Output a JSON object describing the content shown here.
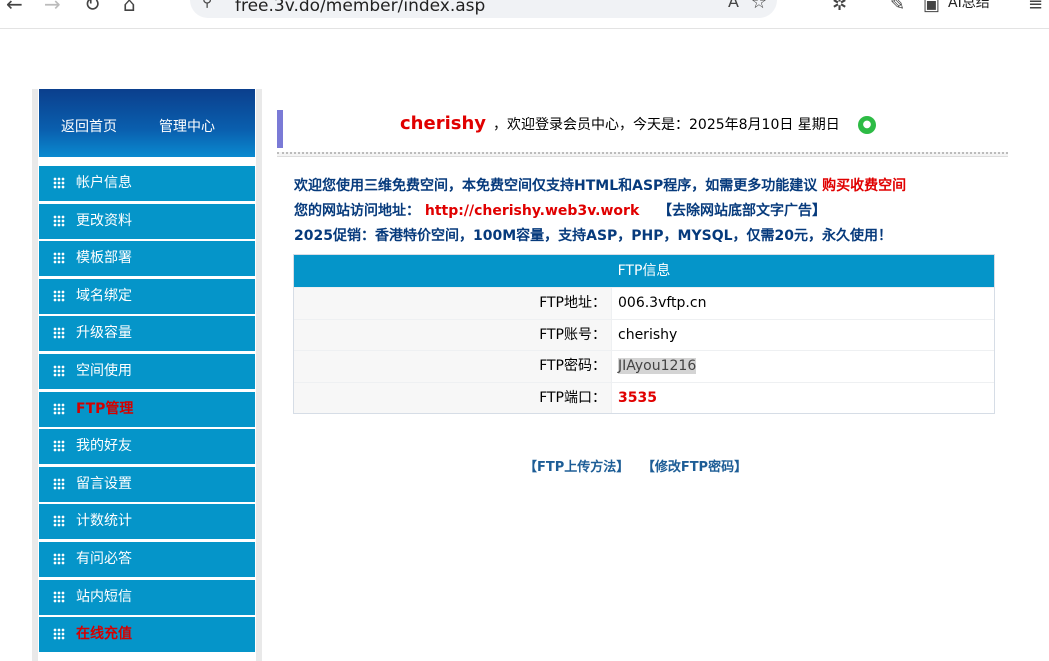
{
  "browser": {
    "url": "free.3v.do/member/index.asp",
    "ai_label": "AI总结"
  },
  "sidebar": {
    "header": [
      "返回首页",
      "管理中心"
    ],
    "items": [
      {
        "label": "帐户信息",
        "active": false
      },
      {
        "label": "更改资料",
        "active": false
      },
      {
        "label": "模板部署",
        "active": false
      },
      {
        "label": "域名绑定",
        "active": false
      },
      {
        "label": "升级容量",
        "active": false
      },
      {
        "label": "空间使用",
        "active": false
      },
      {
        "label": "FTP管理",
        "active": true
      },
      {
        "label": "我的好友",
        "active": false
      },
      {
        "label": "留言设置",
        "active": false
      },
      {
        "label": "计数统计",
        "active": false
      },
      {
        "label": "有问必答",
        "active": false
      },
      {
        "label": "站内短信",
        "active": false
      },
      {
        "label": "在线充值",
        "active": true
      }
    ]
  },
  "welcome": {
    "username": "cherishy",
    "message": "，欢迎登录会员中心，今天是：2025年8月10日 星期日"
  },
  "info": {
    "line1": "欢迎您使用三维免费空间，本免费空间仅支持HTML和ASP程序，如需更多功能建议",
    "line1_link": "购买收费空间",
    "line2": "您的网站访问地址：",
    "line2_url": "http://cherishy.web3v.work",
    "line2_ad": "【去除网站底部文字广告】",
    "line3": "2025促销：香港特价空间，100M容量，支持ASP，PHP，MYSQL，仅需20元，永久使用！"
  },
  "ftp": {
    "title": "FTP信息",
    "rows": [
      {
        "key": "FTP地址：",
        "value": "006.3vftp.cn"
      },
      {
        "key": "FTP账号：",
        "value": "cherishy"
      },
      {
        "key": "FTP密码：",
        "value": "JIAyou1216"
      },
      {
        "key": "FTP端口：",
        "value": "3535"
      }
    ]
  },
  "links": [
    "【FTP上传方法】",
    "【修改FTP密码】"
  ],
  "colors": {
    "sidebar_item": "#0595c9",
    "alert_red": "#e00000",
    "info_blue": "#063a7c"
  }
}
